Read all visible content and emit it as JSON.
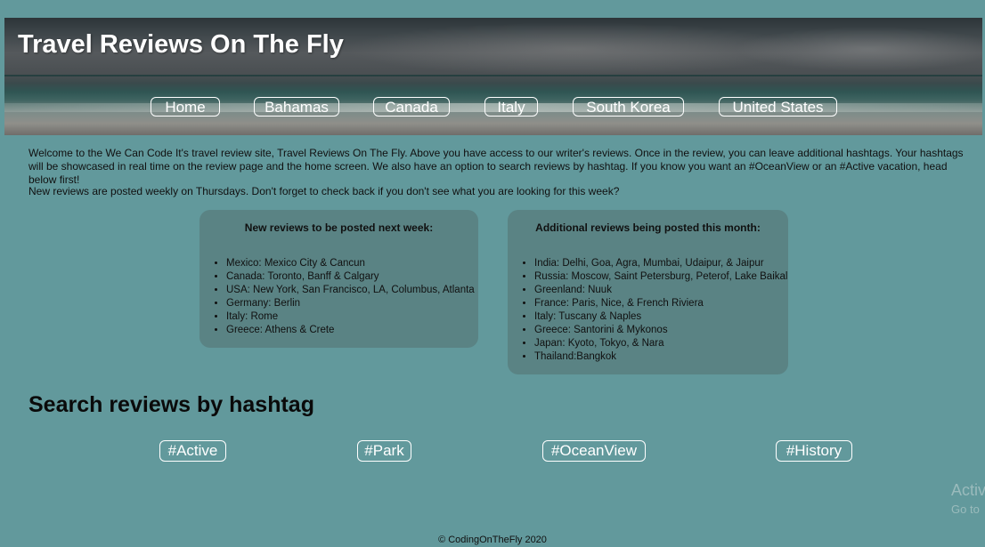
{
  "header": {
    "title": "Travel Reviews On The Fly",
    "nav": [
      "Home",
      "Bahamas",
      "Canada",
      "Italy",
      "South Korea",
      "United States"
    ]
  },
  "intro": {
    "paragraph1": "Welcome to the We Can Code It's travel review site, Travel Reviews On The Fly. Above you have access to our writer's reviews. Once in the review, you can leave additional hashtags. Your hashtags will be showcased in real time on the review page and the home screen. We also have an option to search reviews by hashtag. If you know you want an #OceanView or an #Active vacation, head below first!",
    "paragraph2": "New reviews are posted weekly on Thursdays. Don't forget to check back if you don't see what you are looking for this week?"
  },
  "next_week": {
    "heading": "New reviews to be posted next week:",
    "items": [
      "Mexico: Mexico City & Cancun",
      "Canada: Toronto, Banff & Calgary",
      "USA: New York, San Francisco, LA, Columbus, Atlanta",
      "Germany: Berlin",
      "Italy: Rome",
      "Greece: Athens & Crete"
    ]
  },
  "this_month": {
    "heading": "Additional reviews being posted this month:",
    "items": [
      "India: Delhi, Goa, Agra, Mumbai, Udaipur, & Jaipur",
      "Russia: Moscow, Saint Petersburg, Peterof, Lake Baikal",
      "Greenland: Nuuk",
      "France: Paris, Nice, & French Riviera",
      "Italy: Tuscany & Naples",
      "Greece: Santorini & Mykonos",
      "Japan: Kyoto, Tokyo, & Nara",
      "Thailand:Bangkok"
    ]
  },
  "search": {
    "heading": "Search reviews by hashtag",
    "tags": [
      "#Active",
      "#Park",
      "#OceanView",
      "#History"
    ]
  },
  "watermark": {
    "line1": "Activ",
    "line2": "Go to"
  },
  "footer": {
    "text": "© CodingOnTheFly 2020"
  },
  "colors": {
    "page_background": "#62999c",
    "box_background": "#5a8384",
    "button_border": "#ffffff"
  }
}
